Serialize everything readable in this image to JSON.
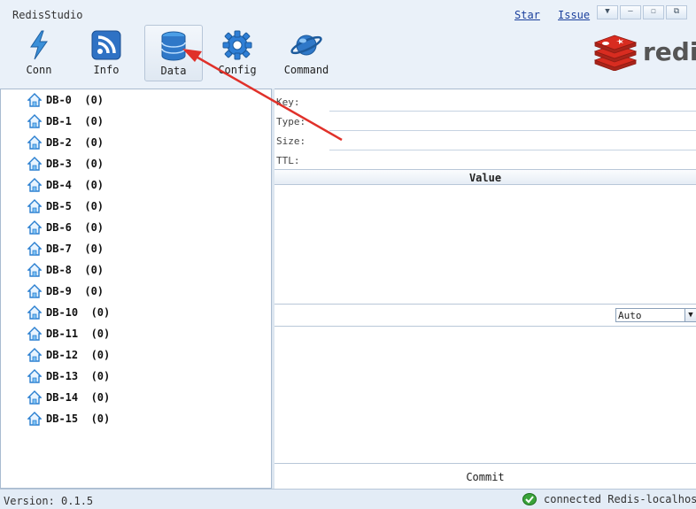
{
  "app": {
    "title": "RedisStudio"
  },
  "links": {
    "star": "Star",
    "issue": "Issue"
  },
  "window_buttons": [
    "▼",
    "—",
    "☐",
    "⧉"
  ],
  "toolbar": {
    "items": [
      {
        "label": "Conn",
        "icon": "lightning-icon"
      },
      {
        "label": "Info",
        "icon": "rss-icon"
      },
      {
        "label": "Data",
        "icon": "database-icon",
        "active": true
      },
      {
        "label": "Config",
        "icon": "gear-icon"
      },
      {
        "label": "Command",
        "icon": "planet-icon"
      }
    ]
  },
  "logo": {
    "text": "redis"
  },
  "databases": [
    "DB-0  (0)",
    "DB-1  (0)",
    "DB-2  (0)",
    "DB-3  (0)",
    "DB-4  (0)",
    "DB-5  (0)",
    "DB-6  (0)",
    "DB-7  (0)",
    "DB-8  (0)",
    "DB-9  (0)",
    "DB-10  (0)",
    "DB-11  (0)",
    "DB-12  (0)",
    "DB-13  (0)",
    "DB-14  (0)",
    "DB-15  (0)"
  ],
  "fields": {
    "key_label": "Key:",
    "key_value": "",
    "type_label": "Type:",
    "type_value": "",
    "size_label": "Size:",
    "size_value": "",
    "ttl_label": "TTL:",
    "ttl_value": ""
  },
  "value_header": "Value",
  "format_select": {
    "selected": "Auto"
  },
  "commit_label": "Commit",
  "status": {
    "version": "Version: 0.1.5",
    "connection": "connected Redis-localhost"
  },
  "colors": {
    "accent": "#1a3f9c",
    "annotation_arrow": "#e0312a",
    "redis_red": "#d82c20"
  }
}
